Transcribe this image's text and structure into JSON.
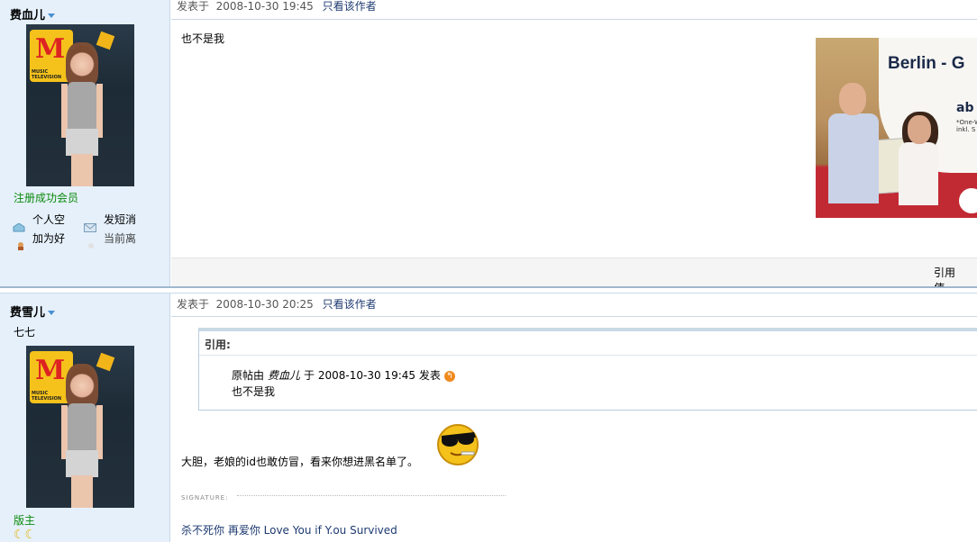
{
  "posts": [
    {
      "author": "费血儿",
      "rank": "注册成功会员",
      "actions": {
        "space": "个人空",
        "message": "发短消",
        "add_friend": "加为好",
        "status": "当前离"
      },
      "posted_label": "发表于",
      "posted_time": "2008-10-30 19:45",
      "only_author": "只看该作者",
      "content": "也不是我",
      "ad": {
        "headline": "Berlin - G",
        "brand_short": "ab",
        "fine_print_1": "*One-W",
        "fine_print_2": "inkl. S"
      },
      "footer_links": {
        "quote": "引用",
        "use": "使"
      }
    },
    {
      "author": "费雪儿",
      "custom_title": "七七",
      "rank": "版主",
      "posted_label": "发表于",
      "posted_time": "2008-10-30 20:25",
      "only_author": "只看该作者",
      "quote": {
        "header": "引用:",
        "prefix": "原帖由",
        "author": "费血儿",
        "mid": "于",
        "time": "2008-10-30 19:45",
        "suffix": "发表",
        "text": "也不是我"
      },
      "content": "大胆，老娘的id也敢仿冒，看来你想进黑名单了。",
      "signature_label": "SIGNATURE:",
      "signature_text": "杀不死你  再爱你  Love You if Y.ou Survived"
    }
  ],
  "colors": {
    "sidebar_bg": "#e5f0fb",
    "rank_green": "#0a8a0a",
    "link_blue": "#1d3a70"
  },
  "icons": [
    "dropdown-icon",
    "home-icon",
    "envelope-icon",
    "friend-icon",
    "status-icon",
    "reply-arrow-icon",
    "sunglasses-smiley-icon",
    "moon-icon"
  ]
}
